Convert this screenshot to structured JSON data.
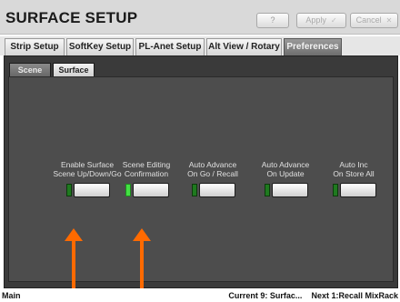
{
  "window": {
    "title": "SURFACE SETUP",
    "help_label": "?",
    "apply_label": "Apply",
    "cancel_label": "Cancel"
  },
  "tabs": [
    {
      "label": "Strip Setup",
      "active": false
    },
    {
      "label": "SoftKey Setup",
      "active": false
    },
    {
      "label": "PL-Anet Setup",
      "active": false
    },
    {
      "label": "Alt View / Rotary",
      "active": false
    },
    {
      "label": "Preferences",
      "active": true
    }
  ],
  "subtabs": [
    {
      "label": "Scene",
      "active": true
    },
    {
      "label": "Surface",
      "active": false
    }
  ],
  "controls": [
    {
      "line1": "Enable Surface",
      "line2": "Scene Up/Down/Go",
      "led_on": false
    },
    {
      "line1": "Scene Editing",
      "line2": "Confirmation",
      "led_on": true
    },
    {
      "line1": "Auto Advance",
      "line2": "On Go / Recall",
      "led_on": false
    },
    {
      "line1": "Auto Advance",
      "line2": "On Update",
      "led_on": false
    },
    {
      "line1": "Auto Inc",
      "line2": "On Store All",
      "led_on": false
    }
  ],
  "status_bar": {
    "left": "Main",
    "current": "Current 9:  Surfac...",
    "next": "Next 1:Recall MixRack"
  },
  "colors": {
    "accent_arrow": "#ff6a00",
    "led_on": "#43e043",
    "led_off": "#1f7a1f",
    "panel_bg": "#3a3a3a"
  }
}
